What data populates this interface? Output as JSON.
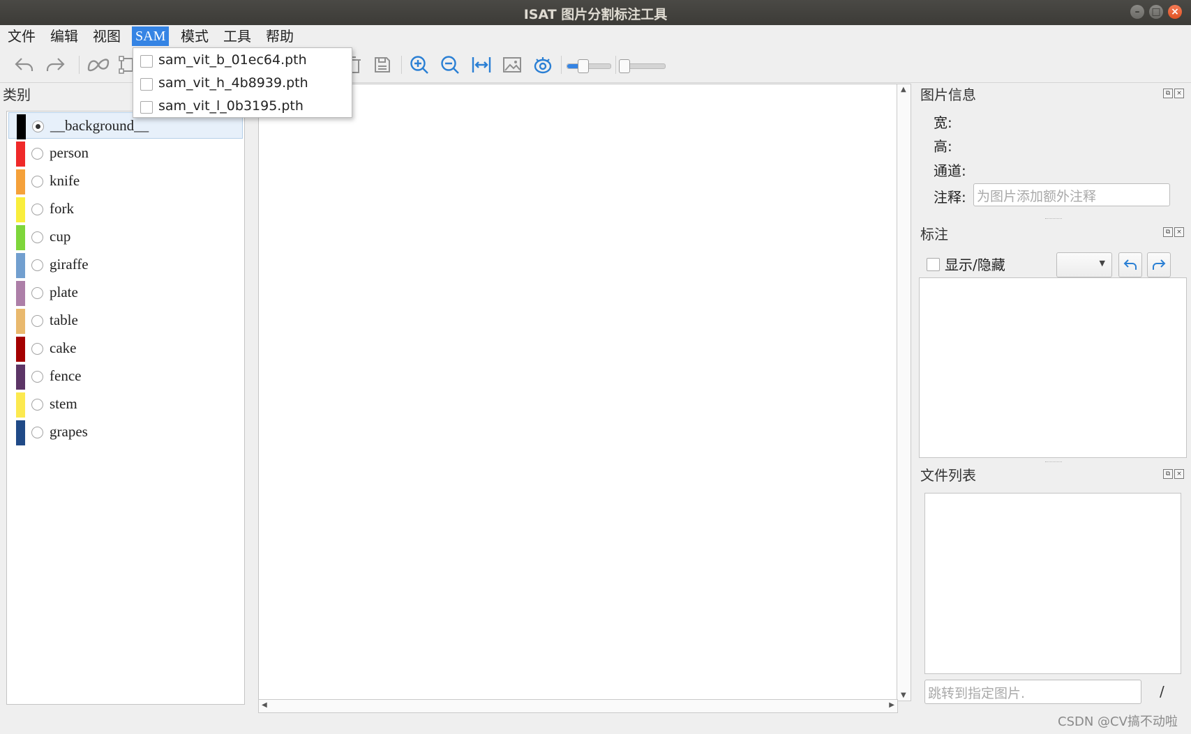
{
  "window": {
    "title": "ISAT 图片分割标注工具"
  },
  "menubar": {
    "items": [
      "文件",
      "编辑",
      "视图",
      "SAM",
      "模式",
      "工具",
      "帮助"
    ],
    "active": "SAM"
  },
  "sam_menu": {
    "items": [
      "sam_vit_b_01ec64.pth",
      "sam_vit_h_4b8939.pth",
      "sam_vit_l_0b3195.pth"
    ]
  },
  "toolbar": {
    "icons": [
      "undo-icon",
      "redo-icon",
      "sam-segment-icon",
      "polygon-icon",
      "delete-icon",
      "save-icon",
      "zoom-in-icon",
      "zoom-out-icon",
      "fit-window-icon",
      "show-image-icon",
      "visible-icon"
    ],
    "slider1_level": 0.35,
    "slider2_level": 0.05
  },
  "category_panel": {
    "title": "类别",
    "items": [
      {
        "label": "__background__",
        "color": "#000000",
        "selected": true
      },
      {
        "label": "person",
        "color": "#ef2929"
      },
      {
        "label": "knife",
        "color": "#f5a13a"
      },
      {
        "label": "fork",
        "color": "#f9ee3c"
      },
      {
        "label": "cup",
        "color": "#7ed63b"
      },
      {
        "label": "giraffe",
        "color": "#729fcf"
      },
      {
        "label": "plate",
        "color": "#ad7fa8"
      },
      {
        "label": "table",
        "color": "#e9b96e"
      },
      {
        "label": "cake",
        "color": "#a40000"
      },
      {
        "label": "fence",
        "color": "#5c3566"
      },
      {
        "label": "stem",
        "color": "#fce94f"
      },
      {
        "label": "grapes",
        "color": "#204a87"
      }
    ]
  },
  "image_info": {
    "title": "图片信息",
    "width_label": "宽:",
    "height_label": "高:",
    "channel_label": "通道:",
    "note_label": "注释:",
    "note_placeholder": "为图片添加额外注释"
  },
  "annotation_panel": {
    "title": "标注",
    "toggle_label": "显示/隐藏"
  },
  "file_list": {
    "title": "文件列表",
    "jump_placeholder": "跳转到指定图片.",
    "page_separator": "/"
  },
  "watermark": "CSDN @CV搞不动啦"
}
